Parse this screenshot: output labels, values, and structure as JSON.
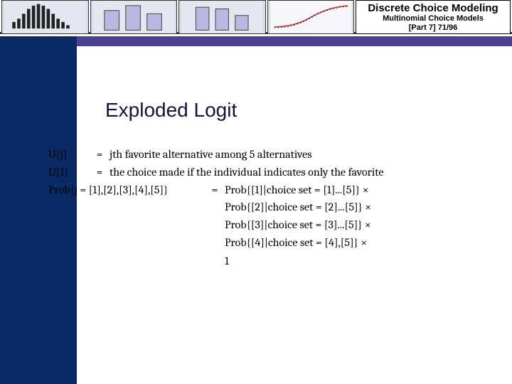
{
  "header": {
    "title": "Discrete Choice Modeling",
    "subtitle": "Multinomial Choice Models",
    "part_label": "[Part 7]   71/96"
  },
  "heading": "Exploded Logit",
  "math": {
    "line1": {
      "lhs": "U[j]",
      "eq": "=",
      "rhs": "jth favorite alternative among 5 alternatives"
    },
    "line2": {
      "lhs": "U[1]",
      "eq": "=",
      "rhs": "the choice made if the individual indicates only the favorite"
    },
    "line3": {
      "lhs": "Prob{j = [1],[2],[3],[4],[5]}",
      "eq": "=",
      "rhs": "Prob{[1]|choice set = [1]...[5]}   ×"
    },
    "p2": "Prob{[2]|choice set = [2]...[5]}   ×",
    "p3": "Prob{[3]|choice set = [3]...[5]}   ×",
    "p4": "Prob{[4]|choice set = [4],[5]}    ×",
    "one": "1"
  },
  "thumb_labels": [
    "hist-thumb",
    "bars-thumb",
    "bars2-thumb",
    "curve-thumb"
  ]
}
